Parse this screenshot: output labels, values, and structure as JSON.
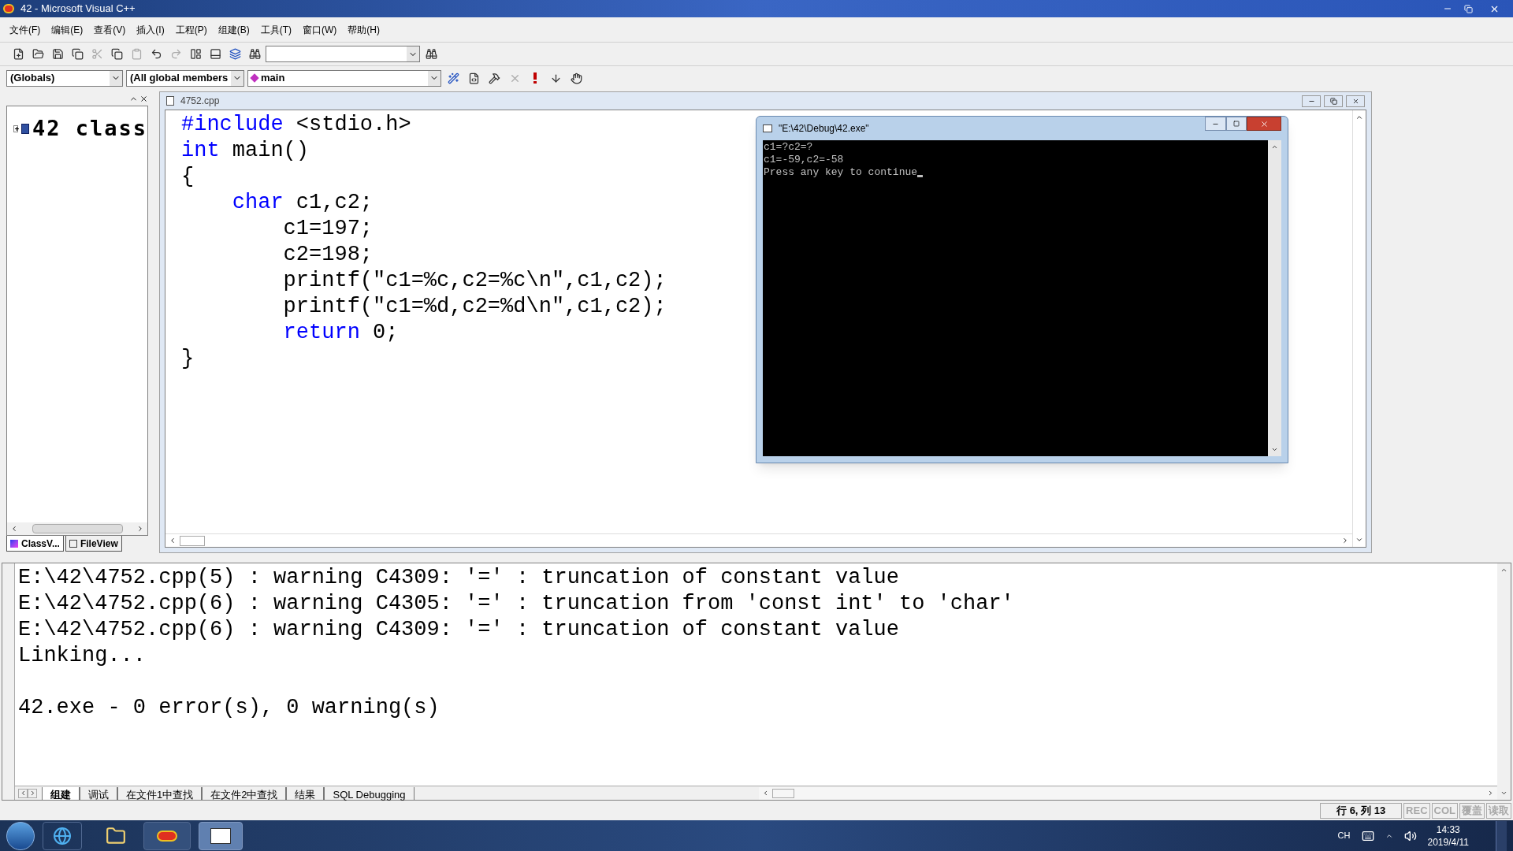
{
  "window": {
    "title": "42 - Microsoft Visual C++"
  },
  "menu": [
    "文件(F)",
    "编辑(E)",
    "查看(V)",
    "插入(I)",
    "工程(P)",
    "组建(B)",
    "工具(T)",
    "窗口(W)",
    "帮助(H)"
  ],
  "wizard_bar": {
    "scope": "(Globals)",
    "members": "(All global members",
    "function": "main"
  },
  "workspace": {
    "tree": [
      {
        "label": "42 class",
        "expanded": false
      }
    ],
    "tabs": [
      {
        "label": "ClassV...",
        "selected": true
      },
      {
        "label": "FileView",
        "selected": false
      }
    ]
  },
  "editor": {
    "title": "4752.cpp",
    "lines": [
      [
        {
          "kind": "keyword",
          "text": "#include"
        },
        {
          "kind": "text",
          "text": " <stdio.h>"
        }
      ],
      [
        {
          "kind": "keyword",
          "text": "int"
        },
        {
          "kind": "text",
          "text": " main()"
        }
      ],
      [
        {
          "kind": "text",
          "text": "{"
        }
      ],
      [
        {
          "kind": "keyword",
          "text": "    char"
        },
        {
          "kind": "text",
          "text": " c1,c2;"
        }
      ],
      [
        {
          "kind": "text",
          "text": "        c1=197;"
        }
      ],
      [
        {
          "kind": "text",
          "text": "        c2=198;"
        }
      ],
      [
        {
          "kind": "text",
          "text": "        printf(\"c1=%c,c2=%c\\n\",c1,c2);"
        }
      ],
      [
        {
          "kind": "text",
          "text": "        printf(\"c1=%d,c2=%d\\n\",c1,c2);"
        }
      ],
      [
        {
          "kind": "keyword",
          "text": "        return"
        },
        {
          "kind": "text",
          "text": " 0;"
        }
      ],
      [
        {
          "kind": "text",
          "text": "}"
        }
      ]
    ]
  },
  "console": {
    "title": "\"E:\\42\\Debug\\42.exe\"",
    "lines": [
      "c1=?c2=?",
      "c1=-59,c2=-58",
      "Press any key to continue"
    ]
  },
  "output": {
    "lines": [
      {
        "text": "E:\\42\\4752.cpp(5) : warning C4309: '=' : truncation of constant value",
        "blank_before": false
      },
      {
        "text": "E:\\42\\4752.cpp(6) : warning C4305: '=' : truncation from 'const int' to 'char'",
        "blank_before": false
      },
      {
        "text": "E:\\42\\4752.cpp(6) : warning C4309: '=' : truncation of constant value",
        "blank_before": false
      },
      {
        "text": "Linking...",
        "blank_before": false
      },
      {
        "text": "42.exe - 0 error(s), 0 warning(s)",
        "blank_before": true
      }
    ],
    "tabs": [
      {
        "label": "组建",
        "selected": true
      },
      {
        "label": "调试",
        "selected": false
      },
      {
        "label": "在文件1中查找",
        "selected": false
      },
      {
        "label": "在文件2中查找",
        "selected": false
      },
      {
        "label": "结果",
        "selected": false
      },
      {
        "label": "SQL Debugging",
        "selected": false
      }
    ]
  },
  "status_bar": {
    "position": "行 6, 列 13",
    "indicators": [
      {
        "label": "REC",
        "on": false
      },
      {
        "label": "COL",
        "on": false
      },
      {
        "label": "覆盖",
        "on": false
      },
      {
        "label": "读取",
        "on": false
      }
    ]
  },
  "taskbar": {
    "language": "CH",
    "time": "14:33",
    "date": "2019/4/11"
  }
}
